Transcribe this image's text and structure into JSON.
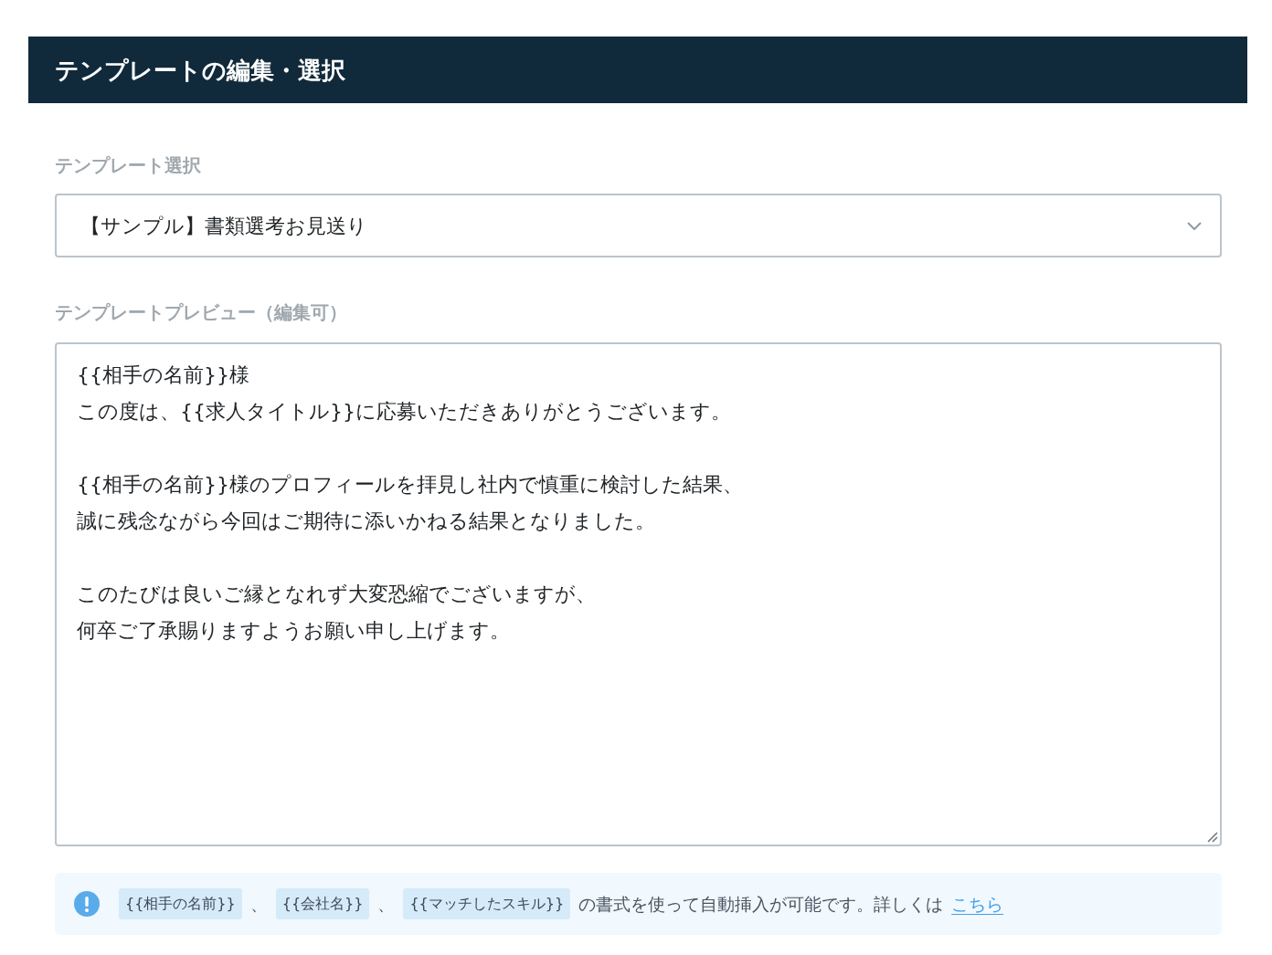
{
  "header": {
    "title": "テンプレートの編集・選択"
  },
  "template_select": {
    "label": "テンプレート選択",
    "value": "【サンプル】書類選考お見送り"
  },
  "template_preview": {
    "label": "テンプレートプレビュー（編集可）",
    "paragraphs": [
      [
        "{{相手の名前}}様",
        "この度は、{{求人タイトル}}に応募いただきありがとうございます。"
      ],
      [
        "{{相手の名前}}様のプロフィールを拝見し社内で慎重に検討した結果、",
        "誠に残念ながら今回はご期待に添いかねる結果となりました。"
      ],
      [
        "このたびは良いご縁となれず大変恐縮でございますが、",
        "何卒ご了承賜りますようお願い申し上げます。"
      ]
    ]
  },
  "note": {
    "items": [
      {
        "kind": "tag",
        "text": "{{相手の名前}}"
      },
      {
        "kind": "text",
        "text": "、"
      },
      {
        "kind": "tag",
        "text": "{{会社名}}"
      },
      {
        "kind": "text",
        "text": "、"
      },
      {
        "kind": "tag",
        "text": "{{マッチしたスキル}}"
      },
      {
        "kind": "text",
        "text": "の書式を使って自動挿入が可能です。詳しくは"
      },
      {
        "kind": "link",
        "text": "こちら"
      }
    ]
  }
}
